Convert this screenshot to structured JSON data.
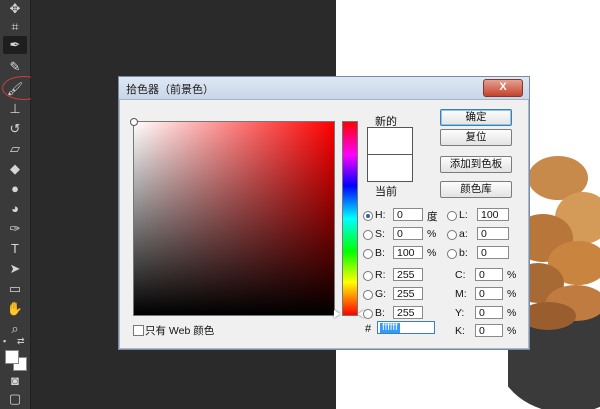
{
  "dialog": {
    "title": "拾色器（前景色）",
    "close_label": "X",
    "buttons": {
      "ok": "确定",
      "reset": "复位",
      "add_swatch": "添加到色板",
      "color_library": "颜色库"
    },
    "new_label": "新的",
    "current_label": "当前",
    "web_only_label": "只有 Web 颜色",
    "hsb": [
      {
        "label": "H:",
        "value": "0",
        "unit": "度"
      },
      {
        "label": "S:",
        "value": "0",
        "unit": "%"
      },
      {
        "label": "B:",
        "value": "100",
        "unit": "%"
      }
    ],
    "rgb": [
      {
        "label": "R:",
        "value": "255"
      },
      {
        "label": "G:",
        "value": "255"
      },
      {
        "label": "B:",
        "value": "255"
      }
    ],
    "lab": [
      {
        "label": "L:",
        "value": "100"
      },
      {
        "label": "a:",
        "value": "0"
      },
      {
        "label": "b:",
        "value": "0"
      }
    ],
    "cmyk": [
      {
        "label": "C:",
        "value": "0",
        "unit": "%"
      },
      {
        "label": "M:",
        "value": "0",
        "unit": "%"
      },
      {
        "label": "Y:",
        "value": "0",
        "unit": "%"
      },
      {
        "label": "K:",
        "value": "0",
        "unit": "%"
      }
    ],
    "hex_label": "#",
    "hex_value": "ffffff",
    "new_color": "#ffffff",
    "current_color": "#ffffff"
  },
  "toolbar": {
    "icons": [
      "crop-icon",
      "eyedropper-icon",
      "healing-brush-icon",
      "brush-icon",
      "stamp-icon",
      "history-brush-icon",
      "eraser-icon",
      "paint-bucket-icon",
      "blur-icon",
      "dodge-icon",
      "pen-icon",
      "type-icon",
      "path-select-icon",
      "shape-icon",
      "hand-icon",
      "zoom-icon"
    ],
    "type_glyph": "T",
    "foreground_color": "#ffffff",
    "background_color": "#ffffff"
  }
}
